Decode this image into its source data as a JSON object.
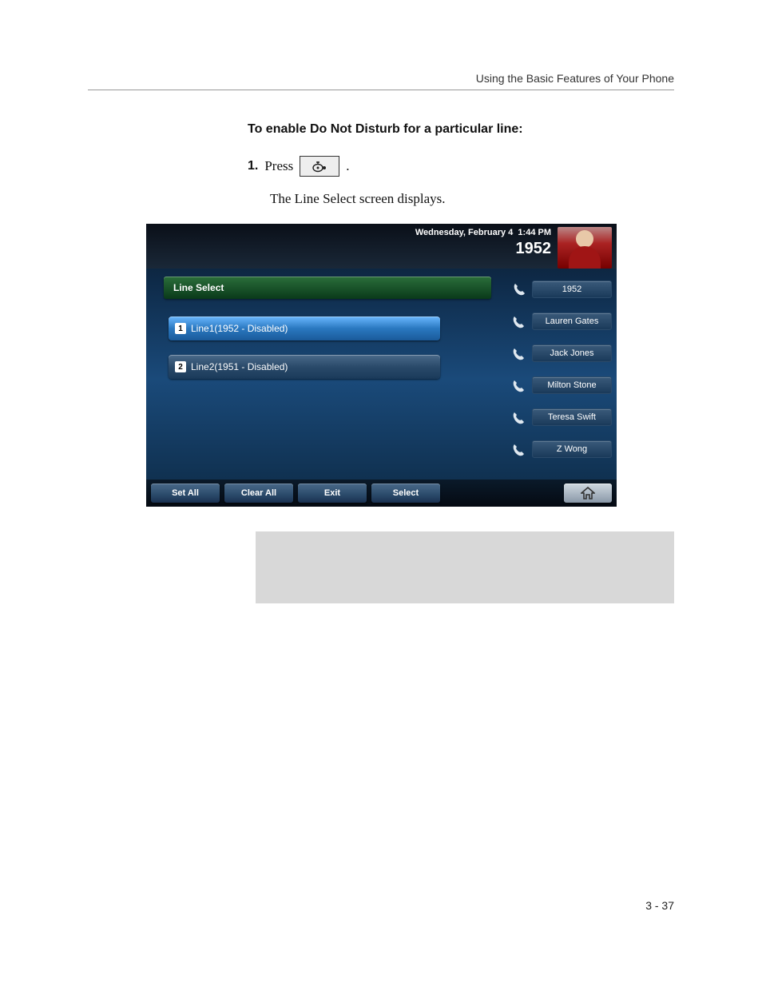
{
  "runningHead": "Using the Basic Features of Your Phone",
  "heading": "To enable Do Not Disturb for a particular line:",
  "step": {
    "num": "1.",
    "verb": "Press",
    "period": "."
  },
  "subtext": "The Line Select screen displays.",
  "phone": {
    "date": "Wednesday, February 4",
    "time": "1:44 PM",
    "ext": "1952",
    "panelTitle": "Line Select",
    "lines": [
      {
        "badge": "1",
        "label": "Line1(1952 - Disabled)"
      },
      {
        "badge": "2",
        "label": "Line2(1951 - Disabled)"
      }
    ],
    "side": [
      {
        "icon": "handset",
        "label": "1952"
      },
      {
        "icon": "phonebook",
        "label": "Lauren Gates"
      },
      {
        "icon": "phonebook",
        "label": "Jack Jones"
      },
      {
        "icon": "phonebook",
        "label": "Milton Stone"
      },
      {
        "icon": "phonebook",
        "label": "Teresa Swift"
      },
      {
        "icon": "phonebook",
        "label": "Z Wong"
      }
    ],
    "softkeys": [
      "Set All",
      "Clear All",
      "Exit",
      "Select"
    ]
  },
  "pageNum": "3 - 37"
}
